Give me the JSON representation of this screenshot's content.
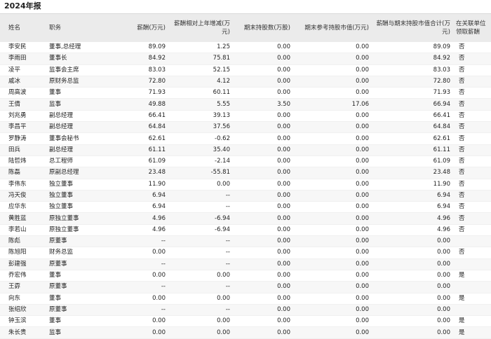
{
  "title": "2024年报",
  "columns": {
    "name": "姓名",
    "position": "职务",
    "salary": "薪酬(万元)",
    "change": "薪酬相对上年增减(万元)",
    "shares": "期末持股数(万股)",
    "value": "期末参考持股市值(万元)",
    "total": "薪酬与期末持股市值合计(万元)",
    "assoc": "在关联单位领取薪酬"
  },
  "rows": [
    {
      "name": "李安民",
      "position": "董事,总经理",
      "salary": "89.09",
      "change": "1.25",
      "shares": "0.00",
      "value": "0.00",
      "total": "89.09",
      "assoc": "否"
    },
    {
      "name": "李雨田",
      "position": "董事长",
      "salary": "84.92",
      "change": "75.81",
      "shares": "0.00",
      "value": "0.00",
      "total": "84.92",
      "assoc": "否"
    },
    {
      "name": "凌平",
      "position": "监事会主席",
      "salary": "83.03",
      "change": "52.15",
      "shares": "0.00",
      "value": "0.00",
      "total": "83.03",
      "assoc": "否"
    },
    {
      "name": "戚冰",
      "position": "原财务总监",
      "salary": "72.80",
      "change": "4.12",
      "shares": "0.00",
      "value": "0.00",
      "total": "72.80",
      "assoc": "否"
    },
    {
      "name": "周高波",
      "position": "董事",
      "salary": "71.93",
      "change": "60.11",
      "shares": "0.00",
      "value": "0.00",
      "total": "71.93",
      "assoc": "否"
    },
    {
      "name": "王倩",
      "position": "监事",
      "salary": "49.88",
      "change": "5.55",
      "shares": "3.50",
      "value": "17.06",
      "total": "66.94",
      "assoc": "否"
    },
    {
      "name": "刘兆勇",
      "position": "副总经理",
      "salary": "66.41",
      "change": "39.13",
      "shares": "0.00",
      "value": "0.00",
      "total": "66.41",
      "assoc": "否"
    },
    {
      "name": "李昌平",
      "position": "副总经理",
      "salary": "64.84",
      "change": "37.56",
      "shares": "0.00",
      "value": "0.00",
      "total": "64.84",
      "assoc": "否"
    },
    {
      "name": "罗静涛",
      "position": "董事会秘书",
      "salary": "62.61",
      "change": "-0.62",
      "shares": "0.00",
      "value": "0.00",
      "total": "62.61",
      "assoc": "否"
    },
    {
      "name": "田兵",
      "position": "副总经理",
      "salary": "61.11",
      "change": "35.40",
      "shares": "0.00",
      "value": "0.00",
      "total": "61.11",
      "assoc": "否"
    },
    {
      "name": "陆哲炜",
      "position": "总工程师",
      "salary": "61.09",
      "change": "-2.14",
      "shares": "0.00",
      "value": "0.00",
      "total": "61.09",
      "assoc": "否"
    },
    {
      "name": "陈磊",
      "position": "原副总经理",
      "salary": "23.48",
      "change": "-55.81",
      "shares": "0.00",
      "value": "0.00",
      "total": "23.48",
      "assoc": "否"
    },
    {
      "name": "李伟东",
      "position": "独立董事",
      "salary": "11.90",
      "change": "0.00",
      "shares": "0.00",
      "value": "0.00",
      "total": "11.90",
      "assoc": "否"
    },
    {
      "name": "冯天俊",
      "position": "独立董事",
      "salary": "6.94",
      "change": "--",
      "shares": "0.00",
      "value": "0.00",
      "total": "6.94",
      "assoc": "否"
    },
    {
      "name": "应华东",
      "position": "独立董事",
      "salary": "6.94",
      "change": "--",
      "shares": "0.00",
      "value": "0.00",
      "total": "6.94",
      "assoc": "否"
    },
    {
      "name": "黄胜蓝",
      "position": "原独立董事",
      "salary": "4.96",
      "change": "-6.94",
      "shares": "0.00",
      "value": "0.00",
      "total": "4.96",
      "assoc": "否"
    },
    {
      "name": "李若山",
      "position": "原独立董事",
      "salary": "4.96",
      "change": "-6.94",
      "shares": "0.00",
      "value": "0.00",
      "total": "4.96",
      "assoc": "否"
    },
    {
      "name": "陈彪",
      "position": "原董事",
      "salary": "--",
      "change": "--",
      "shares": "0.00",
      "value": "0.00",
      "total": "0.00",
      "assoc": ""
    },
    {
      "name": "陈旭阳",
      "position": "财务总监",
      "salary": "0.00",
      "change": "--",
      "shares": "0.00",
      "value": "0.00",
      "total": "0.00",
      "assoc": "否"
    },
    {
      "name": "彭建强",
      "position": "原董事",
      "salary": "--",
      "change": "--",
      "shares": "0.00",
      "value": "0.00",
      "total": "0.00",
      "assoc": ""
    },
    {
      "name": "乔宏伟",
      "position": "董事",
      "salary": "0.00",
      "change": "0.00",
      "shares": "0.00",
      "value": "0.00",
      "total": "0.00",
      "assoc": "是"
    },
    {
      "name": "王孬",
      "position": "原董事",
      "salary": "--",
      "change": "--",
      "shares": "0.00",
      "value": "0.00",
      "total": "0.00",
      "assoc": ""
    },
    {
      "name": "向东",
      "position": "董事",
      "salary": "0.00",
      "change": "0.00",
      "shares": "0.00",
      "value": "0.00",
      "total": "0.00",
      "assoc": "是"
    },
    {
      "name": "张绍欣",
      "position": "原董事",
      "salary": "--",
      "change": "--",
      "shares": "0.00",
      "value": "0.00",
      "total": "0.00",
      "assoc": ""
    },
    {
      "name": "钟玉滨",
      "position": "董事",
      "salary": "0.00",
      "change": "0.00",
      "shares": "0.00",
      "value": "0.00",
      "total": "0.00",
      "assoc": "是"
    },
    {
      "name": "朱长贵",
      "position": "监事",
      "salary": "0.00",
      "change": "0.00",
      "shares": "0.00",
      "value": "0.00",
      "total": "0.00",
      "assoc": "是"
    }
  ]
}
